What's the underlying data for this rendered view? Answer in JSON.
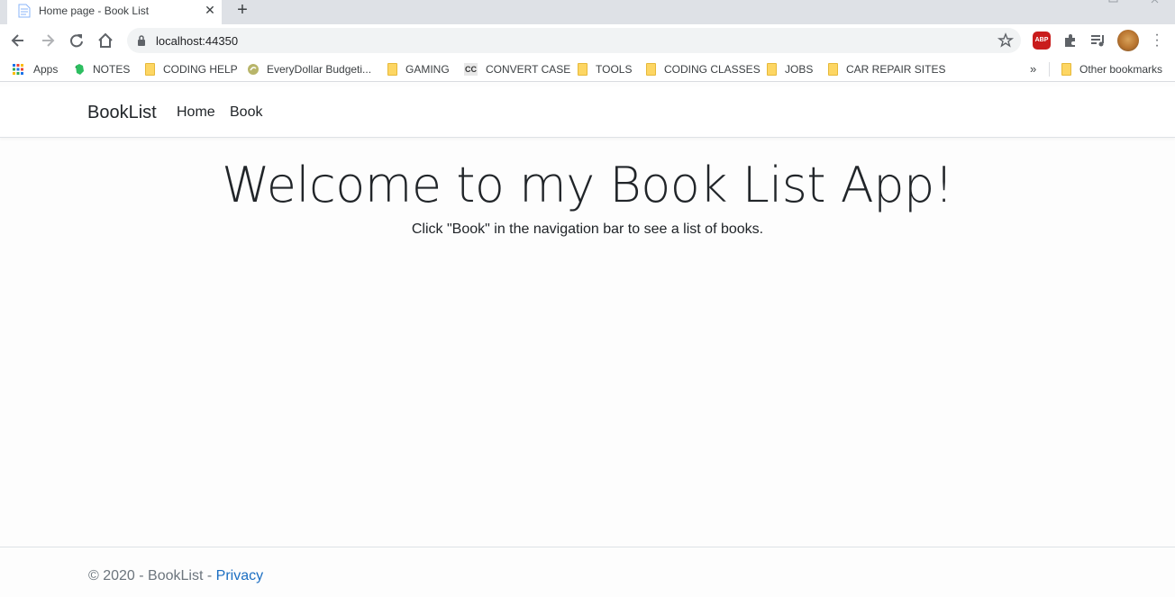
{
  "browser": {
    "tab_title": "Home page - Book List",
    "close_glyph": "✕",
    "new_tab_glyph": "+",
    "url": "localhost:44350",
    "abp_label": "ABP",
    "overflow_glyph": "»"
  },
  "bookmarks": [
    {
      "label": "Apps",
      "icon": "apps-grid-icon"
    },
    {
      "label": "NOTES",
      "icon": "evernote-icon"
    },
    {
      "label": "CODING HELP",
      "icon": "folder-icon"
    },
    {
      "label": "EveryDollar Budgeti...",
      "icon": "everydollar-icon"
    },
    {
      "label": "GAMING",
      "icon": "folder-icon"
    },
    {
      "label": "CONVERT CASE",
      "icon": "cc-icon"
    },
    {
      "label": "TOOLS",
      "icon": "folder-icon"
    },
    {
      "label": "CODING CLASSES",
      "icon": "folder-icon"
    },
    {
      "label": "JOBS",
      "icon": "folder-icon"
    },
    {
      "label": "CAR REPAIR SITES",
      "icon": "folder-icon"
    },
    {
      "label": "Other bookmarks",
      "icon": "folder-icon"
    }
  ],
  "cc_text": "CC",
  "site": {
    "brand": "BookList",
    "nav": [
      "Home",
      "Book"
    ],
    "heading": "Welcome to my Book List App!",
    "subtext": "Click \"Book\" in the navigation bar to see a list of books.",
    "footer_text": "© 2020 - BookList - ",
    "footer_link": "Privacy"
  },
  "colors": {
    "link": "#1b6ec2",
    "abp_red": "#c91c1c",
    "folder": "#fdd663"
  }
}
